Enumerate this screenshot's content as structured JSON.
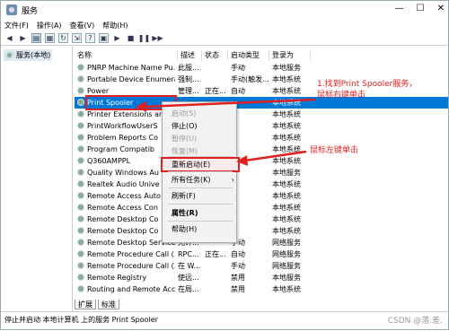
{
  "window": {
    "title": "服务",
    "minimize": "—",
    "maximize": "☐",
    "close": "✕"
  },
  "menubar": [
    "文件(F)",
    "操作(A)",
    "查看(V)",
    "帮助(H)"
  ],
  "toolbar": {
    "icons": [
      "back-icon",
      "forward-icon",
      "console-tree-icon",
      "properties-icon",
      "refresh-icon",
      "export-icon",
      "help-icon",
      "view-icon",
      "play-icon",
      "stop-icon",
      "pause-icon",
      "restart-icon"
    ]
  },
  "left_pane": {
    "node": "服务(本地)"
  },
  "columns": [
    "名称",
    "描述",
    "状态",
    "启动类型",
    "登录为"
  ],
  "rows": [
    {
      "name": "PNRP Machine Name Pu...",
      "desc": "此服...",
      "status": "",
      "startup": "手动",
      "logon": "本地服务"
    },
    {
      "name": "Portable Device Enumera...",
      "desc": "强制...",
      "status": "",
      "startup": "手动(触发...",
      "logon": "本地系统"
    },
    {
      "name": "Power",
      "desc": "管理...",
      "status": "正在...",
      "startup": "自动",
      "logon": "本地系统"
    },
    {
      "name": "Print Spooler",
      "desc": "",
      "status": "",
      "startup": "",
      "logon": "本地系统"
    },
    {
      "name": "Printer Extensions an",
      "desc": "",
      "status": "",
      "startup": "",
      "logon": "本地系统"
    },
    {
      "name": "PrintWorkflowUserS",
      "desc": "",
      "status": "",
      "startup": "",
      "logon": "本地系统"
    },
    {
      "name": "Problem Reports Co",
      "desc": "",
      "status": "",
      "startup": "",
      "logon": "本地系统"
    },
    {
      "name": "Program Compatib",
      "desc": "",
      "status": "",
      "startup": "",
      "logon": "本地系统"
    },
    {
      "name": "Q360AMPPL",
      "desc": "",
      "status": "",
      "startup": "",
      "logon": "本地系统"
    },
    {
      "name": "Quality Windows Au",
      "desc": "",
      "status": "",
      "startup": "",
      "logon": "本地服务"
    },
    {
      "name": "Realtek Audio Unive",
      "desc": "",
      "status": "",
      "startup": "",
      "logon": "本地系统"
    },
    {
      "name": "Remote Access Auto",
      "desc": "",
      "status": "",
      "startup": "",
      "logon": "本地系统"
    },
    {
      "name": "Remote Access Con",
      "desc": "",
      "status": "",
      "startup": "",
      "logon": "本地系统"
    },
    {
      "name": "Remote Desktop Co",
      "desc": "",
      "status": "",
      "startup": "",
      "logon": "本地系统"
    },
    {
      "name": "Remote Desktop Co",
      "desc": "",
      "status": "",
      "startup": "",
      "logon": "本地系统"
    },
    {
      "name": "Remote Desktop Service...",
      "desc": "允许...",
      "status": "",
      "startup": "手动",
      "logon": "网络服务"
    },
    {
      "name": "Remote Procedure Call (...",
      "desc": "RPC...",
      "status": "正在...",
      "startup": "自动",
      "logon": "网络服务"
    },
    {
      "name": "Remote Procedure Call (...",
      "desc": "在 W...",
      "status": "",
      "startup": "手动",
      "logon": "网络服务"
    },
    {
      "name": "Remote Registry",
      "desc": "使远...",
      "status": "",
      "startup": "禁用",
      "logon": "本地服务"
    },
    {
      "name": "Routing and Remote Acc...",
      "desc": "在局...",
      "status": "",
      "startup": "禁用",
      "logon": "本地系统"
    }
  ],
  "context_menu": [
    {
      "label": "启动(S)",
      "disabled": true
    },
    {
      "label": "停止(O)",
      "disabled": false
    },
    {
      "label": "暂停(U)",
      "disabled": true
    },
    {
      "label": "恢复(M)",
      "disabled": true
    },
    {
      "label": "重新启动(E)",
      "disabled": false,
      "highlighted": true
    },
    {
      "label": "所有任务(K)",
      "disabled": false,
      "submenu": "›"
    },
    {
      "label": "刷新(F)",
      "disabled": false
    },
    {
      "label": "属性(R)",
      "disabled": false,
      "bold": true
    },
    {
      "label": "帮助(H)",
      "disabled": false
    }
  ],
  "annotations": {
    "step1": "1.找到Print Spooler服务，",
    "step1b": "鼠标右键单击",
    "step2": "鼠标左键单击"
  },
  "tabs": [
    "扩展",
    "标准"
  ],
  "statusbar": "停止并启动 本地计算机 上的服务 Print Spooler",
  "watermark": "CSDN @落.差.",
  "colors": {
    "selection": "#0078d7",
    "annotation": "#e02020"
  }
}
